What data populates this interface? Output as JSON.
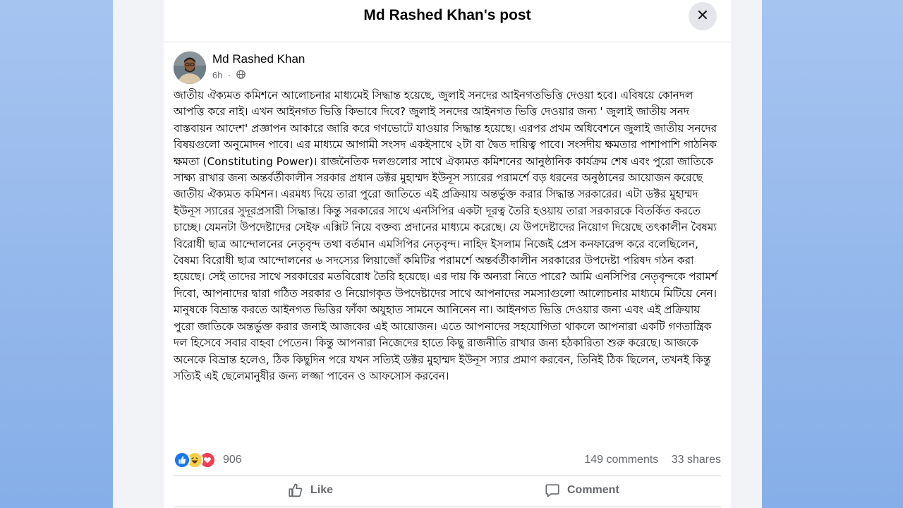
{
  "modal": {
    "title": "Md Rashed Khan's post",
    "close_icon": "close-icon"
  },
  "post": {
    "author": "Md Rashed Khan",
    "time": "6h",
    "privacy_icon": "globe-icon",
    "body": "জাতীয় ঐক্যমত কমিশনে আলোচনার মাধ্যমেই সিদ্ধান্ত হয়েছে, জুলাই সনদের আইনগতভিত্তি দেওয়া হবে। এবিষয়ে কোনদল আপত্তি করে নাই। এখন আইনগত ভিত্তি কিভাবে দিবে? জুলাই সনদের আইনগত ভিত্তি দেওয়ার জন্য ' জুলাই জাতীয় সনদ বাস্তবায়ন আদেশ' প্রজ্ঞাপন আকারে জারি করে গণভোটে যাওয়ার সিদ্ধান্ত হয়েছে। এরপর প্রথম অধিবেশনে জুলাই জাতীয় সনদের বিষয়গুলো অনুমোদন পাবে। এর মাধ্যমে আগামী সংসদ একইসাথে ২টা বা দ্বৈত দায়িত্ব পাবে। সংসদীয় ক্ষমতার পাশাপাশি গাঠনিক ক্ষমতা (Constituting Power)। রাজনৈতিক দলগুলোর সাথে ঐক্যমত কমিশনের আনুষ্ঠানিক কার্যক্রম শেষ এবং পুরো জাতিকে সাক্ষ্য রাখার জন্য অন্তর্বর্তীকালীন সরকার প্রধান ডক্টর মুহাম্মদ ইউনূস স্যারের পরামর্শে বড় ধরনের অনুষ্ঠানের আয়োজন করেছে জাতীয় ঐক্যমত কমিশন। এরমধ্য দিয়ে তারা পুরো জাতিতে এই প্রক্রিয়ায় অন্তর্ভুক্ত করার সিদ্ধান্ত সরকারের। এটা ডক্টর মুহাম্মদ ইউনূস স্যারের সুদূরপ্রসারী সিদ্ধান্ত। কিন্তু সরকারের সাথে এনসিপির একটা দূরত্ব তৈরি হওয়ায় তারা সরকারকে বিতর্কিত করতে চাচ্ছে। যেমনটা উপদেষ্টাদের সেইফ এক্সিট নিয়ে বক্তব্য প্রদানের মাধ্যমে করেছে। যে উপদেষ্টাদের নিয়োগ দিয়েছে তৎকালীন বৈষম্য বিরোধী ছাত্র আন্দোলনের নেতৃবৃন্দ তথা বর্তমান এমসিপির নেতৃবৃন্দ। নাহিদ ইসলাম নিজেই প্রেস কনফারেন্স করে বলেছিলেন, বৈষম্য বিরোধী ছাত্র আন্দোলনের ৬ সদস্যের লিয়াজোঁ কমিটির পরামর্শে অন্তর্বর্তীকালীন সরকারের উপদেষ্টা পরিষদ গঠন করা হয়েছে। সেই তাদের সাথে সরকারের মতবিরোধ তৈরি হয়েছে। এর দায় কি অন্যরা নিতে পারে? আমি এনসিপির নেতৃবৃন্দকে পরামর্শ দিবো, আপনাদের দ্বারা গঠিত সরকার ও নিয়োগকৃত উপদেষ্টাদের সাথে আপনাদের সমস্যাগুলো আলোচনার মাধ্যমে মিটিয়ে নেন। মানুষকে বিভ্রান্ত করতে আইনগত ভিত্তির ফাঁকা অযুহাত সামনে আনিনেন না। আইনগত ভিত্তি দেওয়ার জন্য এবং এই প্রক্রিয়ায় পুরো জাতিকে অন্তর্ভুক্ত করার জন্যই আজকের এই আয়োজন। এতে আপনাদের সহযোগিতা থাকলে আপনারা একটি গণতান্ত্রিক দল হিসেবে সবার বাহবা পেতেন। কিন্তু আপনারা নিজেদের হাতে কিছু রাজনীতি রাখার জন্য হঠকারিতা শুরু করেছে। আজকে অনেকে বিভ্রান্ত হলেও, ঠিক কিছুদিন পরে যখন সত্যিই ডক্টর মুহাম্মদ ইউনূস স্যার প্রমাণ করবেন, তিনিই ঠিক ছিলেন, তখনই কিন্তু সত্যিই এই ছেলেমানুষীর জন্য লজ্জা পাবেন ও আফসোস করবেন।"
  },
  "reactions": {
    "icons": [
      "like-reaction-icon",
      "haha-reaction-icon",
      "love-reaction-icon"
    ],
    "count": "906",
    "colors": {
      "like": "#1877f2",
      "haha": "#f7d04a",
      "love": "#f33e58"
    }
  },
  "stats": {
    "comments": "149 comments",
    "shares": "33 shares"
  },
  "actions": {
    "like_label": "Like",
    "comment_label": "Comment"
  },
  "theme": {
    "background_accent": "#a6c4f0",
    "text_primary": "#050505",
    "text_secondary": "#65676b"
  }
}
